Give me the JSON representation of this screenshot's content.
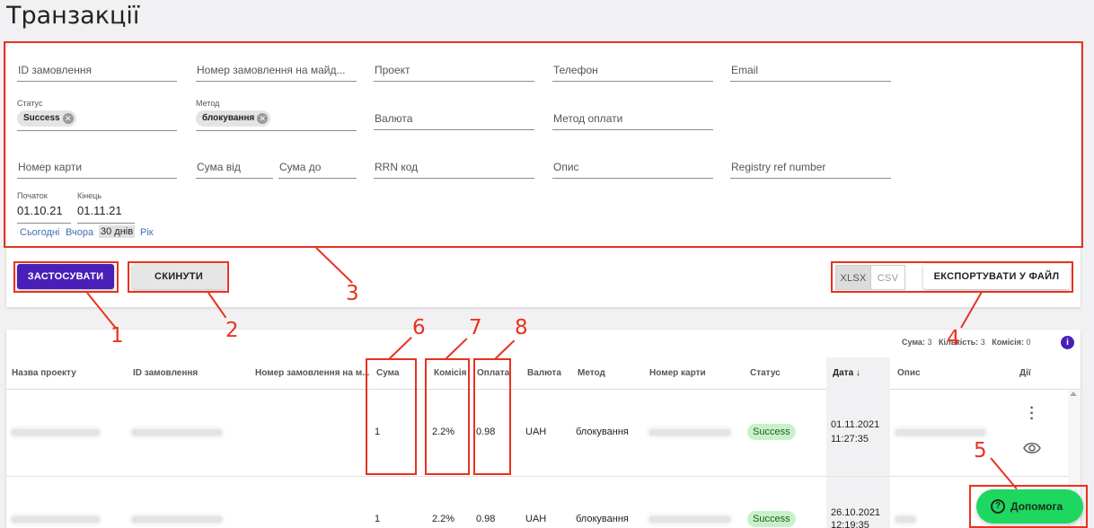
{
  "page": {
    "title": "Транзакції"
  },
  "filters": {
    "order_id": "ID замовлення",
    "site_order_number": "Номер замовлення на майд...",
    "project": "Проект",
    "phone": "Телефон",
    "email": "Email",
    "status_label": "Статус",
    "status_chip": "Success",
    "method_label": "Метод",
    "method_chip": "блокування",
    "currency": "Валюта",
    "payment_method": "Метод оплати",
    "card_number": "Номер карти",
    "amount_from": "Сума від",
    "amount_to": "Сума до",
    "rrn": "RRN код",
    "description": "Опис",
    "registry_ref": "Registry ref number",
    "start_label": "Початок",
    "start_value": "01.10.21",
    "end_label": "Кінець",
    "end_value": "01.11.21",
    "quick_ranges": [
      "Сьогодні",
      "Вчора",
      "30 днів",
      "Рік"
    ]
  },
  "actions": {
    "apply": "ЗАСТОСУВАТИ",
    "reset": "СКИНУТИ",
    "format_xlsx": "XLSX",
    "format_csv": "CSV",
    "export": "ЕКСПОРТУВАТИ У ФАЙЛ"
  },
  "summary": {
    "sum_label": "Сума:",
    "sum_value": "3",
    "count_label": "Кількість:",
    "count_value": "3",
    "fee_label": "Комісія:",
    "fee_value": "0"
  },
  "table": {
    "columns": [
      "Назва проекту",
      "ID замовлення",
      "Номер замовлення на м...",
      "Сума",
      "Комісія",
      "Оплата",
      "Валюта",
      "Метод",
      "Номер карти",
      "Статус",
      "Дата ↓",
      "Опис",
      "Дії"
    ],
    "rows": [
      {
        "amount": "1",
        "fee": "2.2%",
        "payment": "0.98",
        "currency": "UAH",
        "method": "блокування",
        "status": "Success",
        "date": "01.11.2021",
        "time": "11:27:35"
      },
      {
        "amount": "1",
        "fee": "2.2%",
        "payment": "0.98",
        "currency": "UAH",
        "method": "блокування",
        "status": "Success",
        "date": "26.10.2021",
        "time": "12:19:35"
      }
    ]
  },
  "help": {
    "label": "Допомога"
  },
  "annotations": [
    "1",
    "2",
    "3",
    "4",
    "5",
    "6",
    "7",
    "8"
  ],
  "colors": {
    "primary": "#4a1fb8",
    "annotation": "#e8321f",
    "help": "#1ed760",
    "success_bg": "#c9f1c9"
  }
}
